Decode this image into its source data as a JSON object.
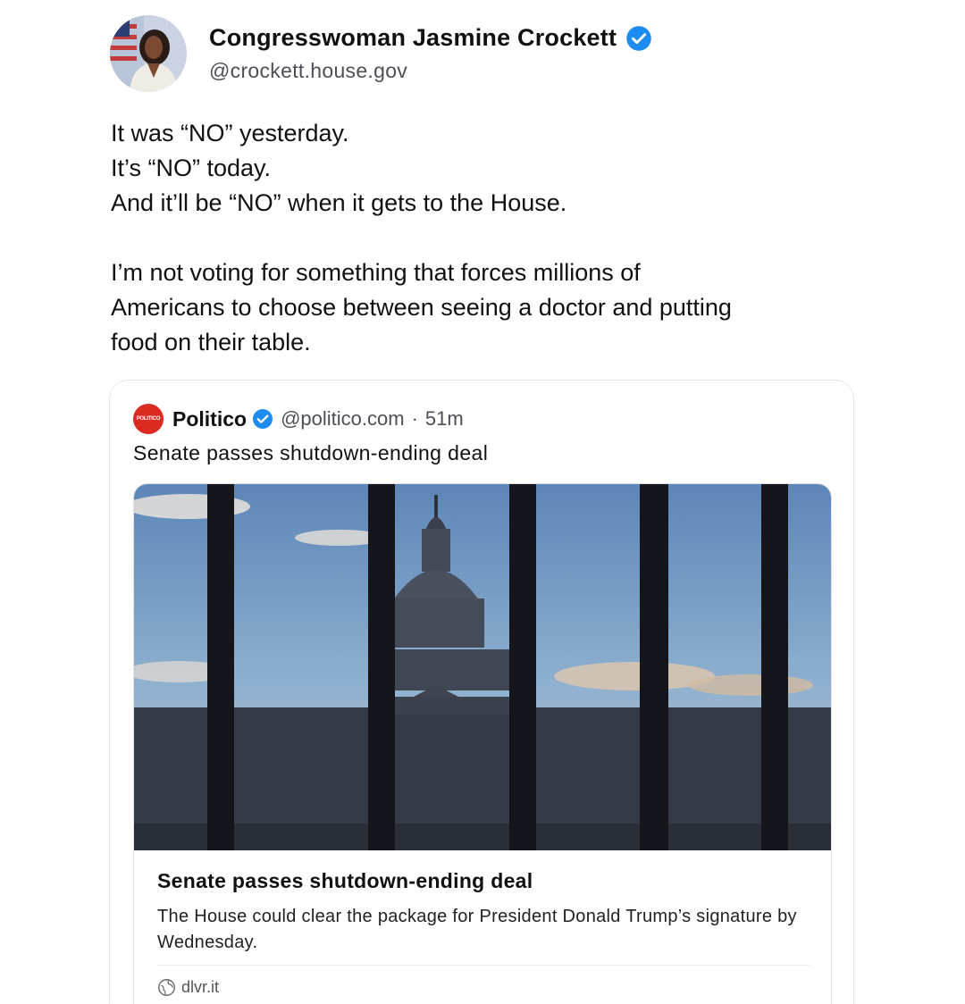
{
  "author": {
    "name": "Congresswoman Jasmine Crockett",
    "handle": "@crockett.house.gov",
    "icons": {
      "avatar": "profile-photo",
      "verified": "verified-badge-icon"
    },
    "colors": {
      "verified": "#1d8cf0"
    }
  },
  "post": {
    "lines": [
      "It was “NO” yesterday.",
      "It’s “NO” today.",
      "And it’ll be “NO” when it gets to the House.",
      "I’m not voting for something that forces millions of",
      "Americans to choose between seeing a doctor and putting",
      "food on their table."
    ]
  },
  "embed": {
    "logo_text": "POLITICO",
    "name": "Politico",
    "handle": "@politico.com",
    "separator": "·",
    "time": "51m",
    "text": "Senate passes shutdown-ending deal",
    "colors": {
      "logo": "#dc2b21"
    },
    "card": {
      "image": "us-capitol-behind-fence-photo",
      "title": "Senate passes shutdown-ending deal",
      "description": "The House could clear the package for President Donald Trump’s signature by Wednesday.",
      "source": "dlvr.it",
      "source_icon": "globe-icon"
    }
  }
}
